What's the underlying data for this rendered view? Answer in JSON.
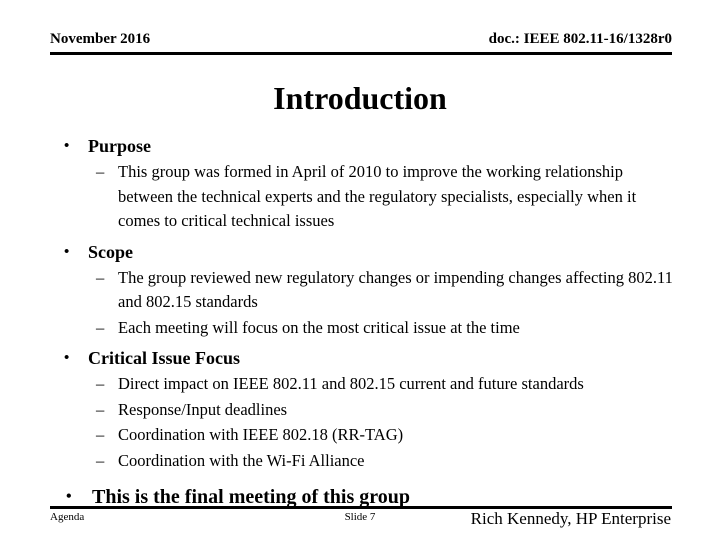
{
  "header": {
    "date": "November 2016",
    "doc": "doc.: IEEE 802.11-16/1328r0"
  },
  "title": "Introduction",
  "sections": [
    {
      "heading": "Purpose",
      "items": [
        "This group was formed in April of 2010 to improve the working relationship between the technical experts and the regulatory specialists, especially when it comes to critical technical issues"
      ]
    },
    {
      "heading": "Scope",
      "items": [
        "The group reviewed new regulatory changes or impending changes affecting 802.11 and 802.15 standards",
        "Each meeting will focus on the most critical issue at the time"
      ]
    },
    {
      "heading": "Critical Issue Focus",
      "items": [
        "Direct impact on IEEE 802.11 and 802.15 current and future standards",
        "Response/Input deadlines",
        "Coordination with IEEE 802.18 (RR-TAG)",
        "Coordination with the Wi-Fi Alliance"
      ]
    }
  ],
  "final_bullet": "This is the final meeting of this group",
  "markers": {
    "bullet": "•",
    "dash": "–"
  },
  "footer": {
    "left": "Agenda",
    "center": "Slide 7",
    "right": "Rich Kennedy, HP Enterprise"
  }
}
